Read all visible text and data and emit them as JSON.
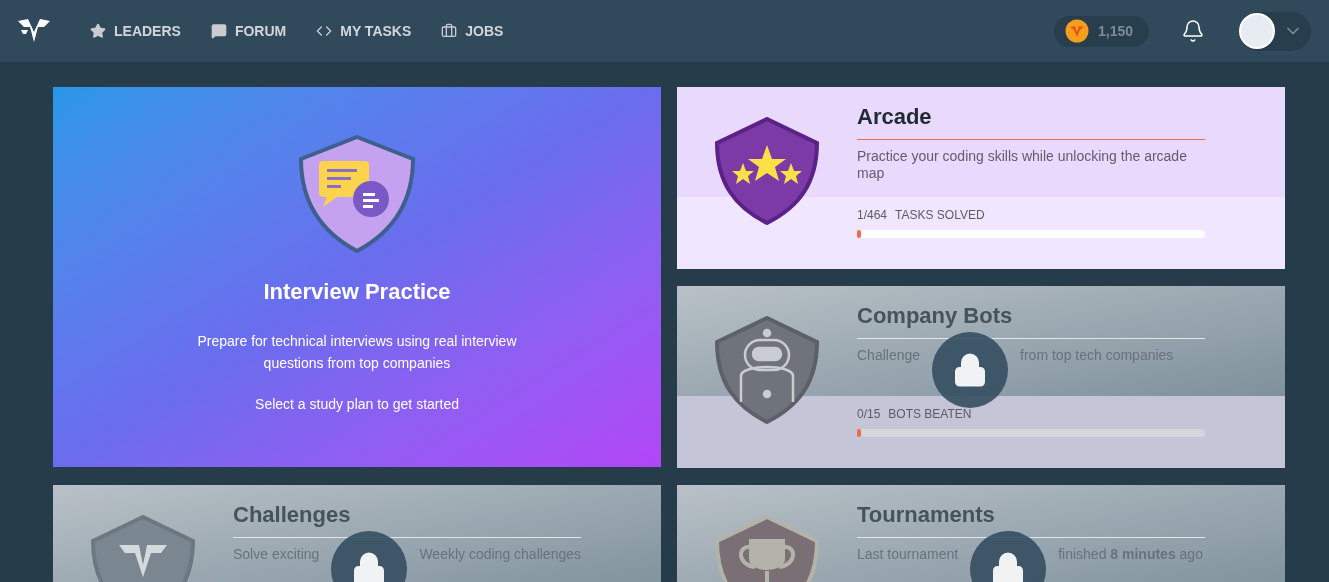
{
  "nav": {
    "items": [
      {
        "label": "LEADERS"
      },
      {
        "label": "FORUM"
      },
      {
        "label": "MY TASKS"
      },
      {
        "label": "JOBS"
      }
    ],
    "coins": "1,150"
  },
  "featured": {
    "title": "Interview Practice",
    "description": "Prepare for technical interviews using real interview questions from top companies",
    "cta": "Select a study plan to get started"
  },
  "cards": [
    {
      "title": "Arcade",
      "description": "Practice your coding skills while unlocking the arcade map",
      "locked": false,
      "progress": {
        "count": "1/464",
        "label": "TASKS SOLVED",
        "level": 0.002
      }
    },
    {
      "title": "Company Bots",
      "description_parts": [
        "Challenge",
        "from top tech companies"
      ],
      "locked": true,
      "progress": {
        "count": "0/15",
        "label": "BOTS BEATEN",
        "level": 0
      }
    },
    {
      "title": "Challenges",
      "description_parts": [
        "Solve exciting",
        "Weekly coding challenges"
      ],
      "locked": true
    },
    {
      "title": "Tournaments",
      "description_parts": [
        "Last tournament",
        "finished **8 minutes** ago"
      ],
      "locked": true
    }
  ]
}
